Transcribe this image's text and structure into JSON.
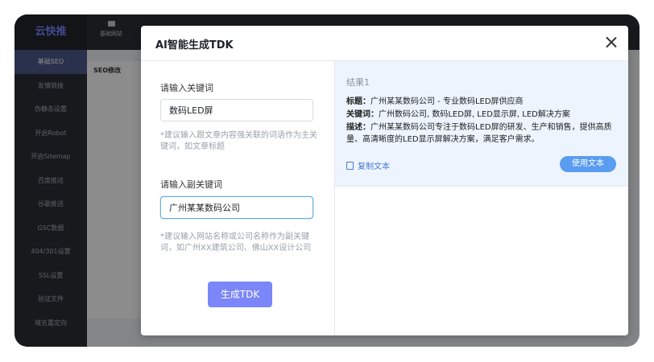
{
  "app": {
    "logo": "云快推",
    "top_nav": {
      "first_label": "基础网站"
    },
    "sidebar": {
      "items": [
        {
          "label": "基础SEO"
        },
        {
          "label": "友情链接"
        },
        {
          "label": "伪静态设置"
        },
        {
          "label": "开启Robot"
        },
        {
          "label": "开启Sitemap"
        },
        {
          "label": "百度推送"
        },
        {
          "label": "谷歌推送"
        },
        {
          "label": "GSC数据"
        },
        {
          "label": "404/301设置"
        },
        {
          "label": "SSL设置"
        },
        {
          "label": "验证文件"
        },
        {
          "label": "域名重定向"
        }
      ]
    },
    "background_panel_title": "SEO修改"
  },
  "modal": {
    "title": "AI智能生成TDK",
    "keyword_label": "请输入关键词",
    "keyword_value": "数码LED屏",
    "keyword_hint": "*建议输入跟文章内容强关联的词语作为主关键词，如文章标题",
    "subkeyword_label": "请输入副关键词",
    "subkeyword_value": "广州某某数码公司",
    "subkeyword_hint": "*建议输入网站名称或公司名称作为副关键词，如广州XX建筑公司、佛山XX设计公司",
    "generate_button": "生成TDK",
    "result": {
      "title": "结果1",
      "title_label": "标题：",
      "title_value": "广州某某数码公司 - 专业数码LED屏供应商",
      "keywords_label": "关键词：",
      "keywords_value": "广州数码公司, 数码LED屏, LED显示屏, LED解决方案",
      "desc_label": "描述：",
      "desc_value": "广州某某数码公司专注于数码LED屏的研发、生产和销售，提供高质量、高清晰度的LED显示屏解决方案，满足客户需求。",
      "copy_button": "复制文本",
      "use_button": "使用文本"
    }
  }
}
